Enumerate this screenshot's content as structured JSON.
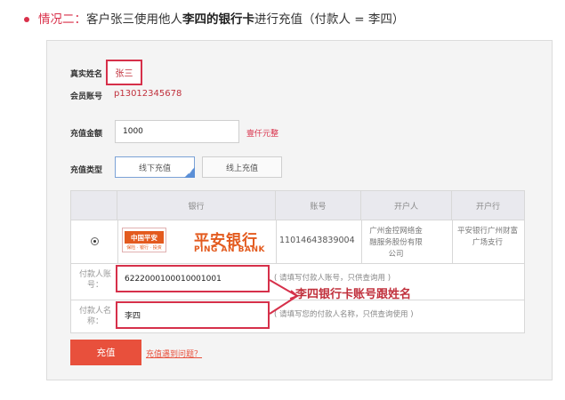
{
  "heading": {
    "prefix": "情况二：",
    "text_before": "客户张三使用他人",
    "bold": "李四的银行卡",
    "text_after": "进行充值（付款人 = 李四）"
  },
  "form": {
    "real_name_label": "真实姓名",
    "real_name_value": "张三",
    "member_account_label": "会员账号",
    "member_account_value": "p13012345678",
    "amount_label": "充值金额",
    "amount_value": "1000",
    "amount_in_words": "壹仟元整",
    "type_label": "充值类型",
    "type_tabs": [
      {
        "label": "线下充值",
        "active": true
      },
      {
        "label": "线上充值",
        "active": false
      }
    ]
  },
  "table": {
    "headers": [
      "银行",
      "账号",
      "开户人",
      "开户行"
    ],
    "bank_logo": {
      "badge": "中国平安",
      "badge_sub": "保险 · 银行 · 投资",
      "name_cn": "平安银行",
      "name_en": "PING AN BANK"
    },
    "account_no": "11014643839004",
    "payee": "广州金控网络金融服务股份有限公司",
    "branch": "平安银行广州财富广场支行",
    "payer_account_label": "付款人账号：",
    "payer_account_value": "6222000100010001001",
    "payer_account_hint": "( 请填写付款人账号，只供查询用 )",
    "payer_name_label": "付款人名称：",
    "payer_name_value": "李四",
    "payer_name_hint": "( 请填写您的付款人名称，只供查询使用 )"
  },
  "annotation": "李四银行卡账号跟姓名",
  "actions": {
    "submit_label": "充值",
    "help_link": "充值遇到问题？"
  },
  "colors": {
    "accent": "#d9304a",
    "button": "#e8503c",
    "bank_orange": "#e35a1e",
    "tab_active": "#5b8fd6"
  }
}
